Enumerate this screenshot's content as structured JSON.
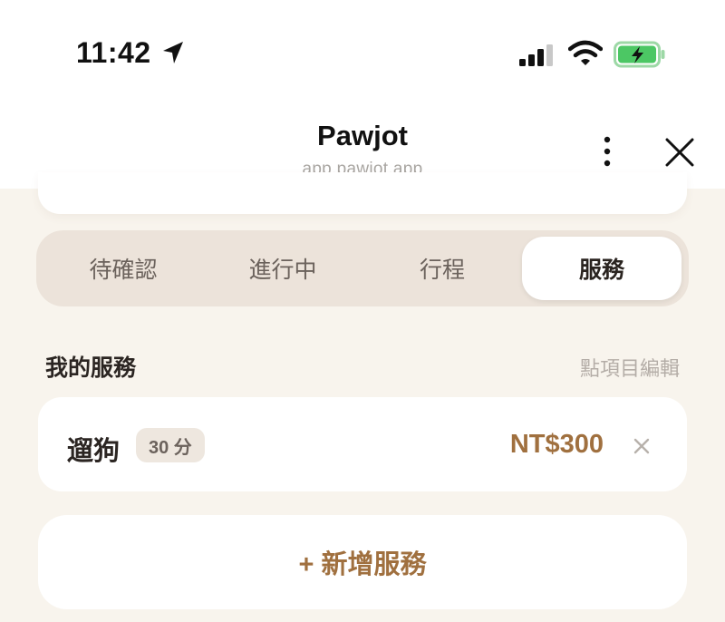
{
  "status_bar": {
    "time": "11:42",
    "battery_color": "#4cc764"
  },
  "browser": {
    "title": "Pawjot",
    "url": "app.pawjot.app"
  },
  "tabs": [
    {
      "label": "待確認",
      "active": false
    },
    {
      "label": "進行中",
      "active": false
    },
    {
      "label": "行程",
      "active": false
    },
    {
      "label": "服務",
      "active": true
    }
  ],
  "section": {
    "title": "我的服務",
    "hint": "點項目編輯"
  },
  "services": [
    {
      "name": "遛狗",
      "duration": "30 分",
      "price": "NT$300"
    }
  ],
  "add_button": {
    "label": "+ 新增服務"
  },
  "colors": {
    "accent": "#a0703f",
    "background": "#f8f4ed",
    "tab_bg": "#ece3da"
  }
}
